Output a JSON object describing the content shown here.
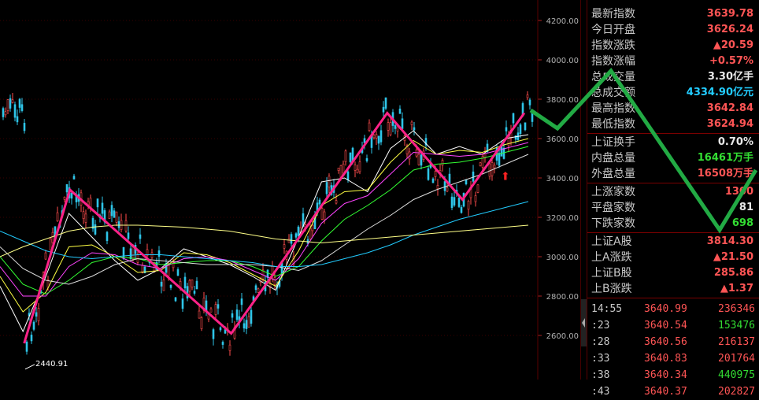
{
  "chart_data": {
    "type": "candlestick",
    "y_axis": {
      "ticks": [
        2600,
        2800,
        3000,
        3200,
        3400,
        3600,
        3800,
        4000,
        4200
      ],
      "tick_labels": [
        "2600.00",
        "2800.00",
        "3000.00",
        "3200.00",
        "3400.00",
        "3600.00",
        "3800.00",
        "4000.00",
        "4200.00"
      ],
      "ylim": [
        2440,
        4300
      ]
    },
    "low_annotation": "2440.91",
    "zigzag_pivots": [
      2560,
      3340,
      2610,
      3730,
      3290,
      3730
    ],
    "zigzag_pivot_positions": [
      0.045,
      0.13,
      0.43,
      0.72,
      0.86,
      0.975
    ],
    "moving_averages": [
      {
        "color": "#ffffff",
        "values": [
          2850,
          2620,
          2900,
          3220,
          3100,
          2980,
          2880,
          2940,
          3040,
          3000,
          2960,
          2900,
          2830,
          3100,
          3380,
          3400,
          3330,
          3550,
          3640,
          3520,
          3560,
          3520,
          3600,
          3620
        ]
      },
      {
        "color": "#ffff44",
        "values": [
          2900,
          2720,
          2820,
          3050,
          3060,
          3000,
          2920,
          2930,
          3020,
          3010,
          2970,
          2910,
          2850,
          3030,
          3260,
          3330,
          3340,
          3480,
          3590,
          3520,
          3540,
          3530,
          3570,
          3600
        ]
      },
      {
        "color": "#ff44ff",
        "values": [
          2950,
          2800,
          2800,
          2950,
          3020,
          3010,
          2960,
          2940,
          2990,
          3000,
          2980,
          2930,
          2880,
          2990,
          3170,
          3270,
          3310,
          3420,
          3530,
          3520,
          3510,
          3520,
          3550,
          3580
        ]
      },
      {
        "color": "#33ff33",
        "values": [
          3000,
          2860,
          2810,
          2880,
          2970,
          3000,
          2990,
          2960,
          2970,
          2980,
          2980,
          2950,
          2900,
          2950,
          3080,
          3190,
          3260,
          3340,
          3440,
          3470,
          3480,
          3500,
          3530,
          3560
        ]
      },
      {
        "color": "#dddddd",
        "values": [
          3050,
          2940,
          2880,
          2860,
          2900,
          2960,
          2990,
          2980,
          2970,
          2960,
          2960,
          2960,
          2950,
          2930,
          2980,
          3060,
          3140,
          3210,
          3290,
          3340,
          3380,
          3420,
          3470,
          3520
        ]
      },
      {
        "color": "#22ccff",
        "values": [
          3130,
          3080,
          3030,
          3000,
          2990,
          3000,
          3010,
          3010,
          3000,
          2990,
          2980,
          2970,
          2950,
          2950,
          2960,
          2990,
          3020,
          3060,
          3110,
          3150,
          3190,
          3220,
          3250,
          3280
        ]
      },
      {
        "color": "#ffff88",
        "values": [
          3000,
          3050,
          3090,
          3130,
          3150,
          3160,
          3160,
          3155,
          3150,
          3140,
          3130,
          3110,
          3090,
          3080,
          3070,
          3080,
          3090,
          3100,
          3110,
          3120,
          3130,
          3140,
          3150,
          3160
        ]
      }
    ],
    "marker": "⬆"
  },
  "panel": {
    "stats_top": [
      {
        "label": "最新指数",
        "value": "3639.78",
        "color": "red"
      },
      {
        "label": "今日开盘",
        "value": "3626.24",
        "color": "red"
      },
      {
        "label": "指数涨跌",
        "value": "▲20.59",
        "color": "red"
      },
      {
        "label": "指数涨幅",
        "value": "+0.57%",
        "color": "red"
      },
      {
        "label": "总成交量",
        "value": "3.30亿手",
        "color": "white"
      },
      {
        "label": "总成交额",
        "value": "4334.90亿元",
        "color": "cyan"
      },
      {
        "label": "最高指数",
        "value": "3642.84",
        "color": "red"
      },
      {
        "label": "最低指数",
        "value": "3624.94",
        "color": "red"
      }
    ],
    "stats_mid": [
      {
        "label": "上证换手",
        "value": "0.70%",
        "color": "white"
      },
      {
        "label": "内盘总量",
        "value": "16461万手",
        "color": "green"
      },
      {
        "label": "外盘总量",
        "value": "16508万手",
        "color": "red"
      }
    ],
    "stats_breadth": [
      {
        "label": "上涨家数",
        "value": "1300",
        "color": "red"
      },
      {
        "label": "平盘家数",
        "value": "81",
        "color": "white"
      },
      {
        "label": "下跌家数",
        "value": "698",
        "color": "green"
      }
    ],
    "stats_ab": [
      {
        "label": "上证A股",
        "value": "3814.30",
        "color": "red"
      },
      {
        "label": "上A涨跌",
        "value": "▲21.50",
        "color": "red"
      },
      {
        "label": "上证B股",
        "value": "285.86",
        "color": "red"
      },
      {
        "label": "上B涨跌",
        "value": "▲1.37",
        "color": "red"
      }
    ],
    "ticks": [
      {
        "time": "14:55",
        "price": "3640.99",
        "volume": "236346",
        "color": "red"
      },
      {
        "time": ":23",
        "price": "3640.54",
        "volume": "153476",
        "color": "green"
      },
      {
        "time": ":28",
        "price": "3640.56",
        "volume": "216137",
        "color": "red"
      },
      {
        "time": ":33",
        "price": "3640.83",
        "volume": "201764",
        "color": "red"
      },
      {
        "time": ":38",
        "price": "3640.34",
        "volume": "440975",
        "color": "green"
      },
      {
        "time": ":43",
        "price": "3640.37",
        "volume": "202827",
        "color": "red"
      }
    ]
  }
}
